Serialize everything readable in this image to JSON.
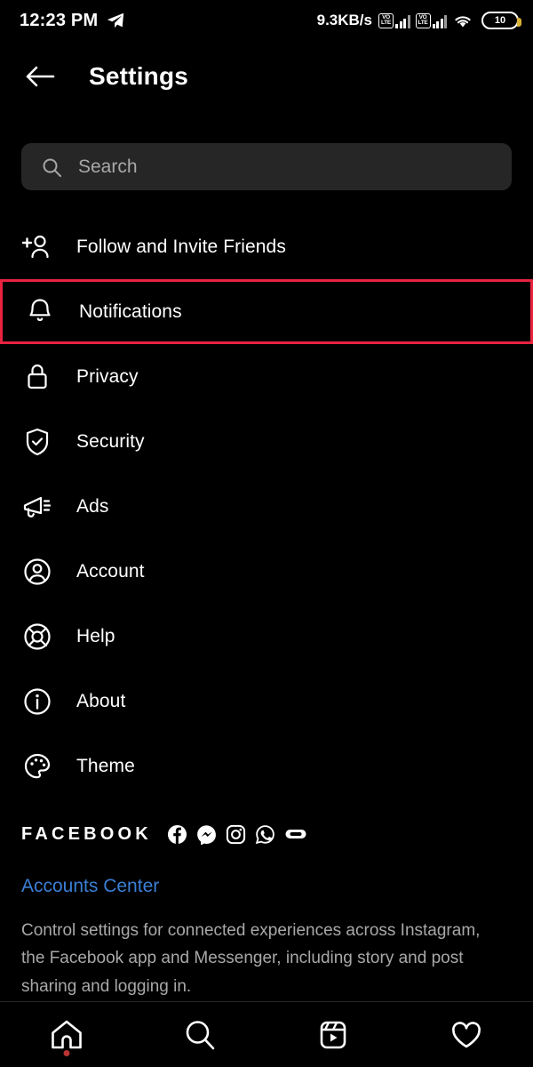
{
  "status_bar": {
    "time": "12:23 PM",
    "send_icon": "telegram-send-icon",
    "network_speed": "9.3KB/s",
    "volte_1": {
      "top": "VO",
      "bottom": "LTE"
    },
    "volte_2": {
      "top": "VO",
      "bottom": "LTE"
    },
    "wifi_icon": "wifi-icon",
    "battery_level": "10"
  },
  "header": {
    "back_icon": "back-arrow-icon",
    "title": "Settings"
  },
  "search": {
    "icon": "search-icon",
    "placeholder": "Search",
    "value": ""
  },
  "menu": {
    "items": [
      {
        "label": "Follow and Invite Friends",
        "icon": "person-add-icon",
        "highlighted": false
      },
      {
        "label": "Notifications",
        "icon": "bell-icon",
        "highlighted": true
      },
      {
        "label": "Privacy",
        "icon": "lock-icon",
        "highlighted": false
      },
      {
        "label": "Security",
        "icon": "shield-check-icon",
        "highlighted": false
      },
      {
        "label": "Ads",
        "icon": "megaphone-icon",
        "highlighted": false
      },
      {
        "label": "Account",
        "icon": "account-circle-icon",
        "highlighted": false
      },
      {
        "label": "Help",
        "icon": "lifebuoy-icon",
        "highlighted": false
      },
      {
        "label": "About",
        "icon": "info-circle-icon",
        "highlighted": false
      },
      {
        "label": "Theme",
        "icon": "palette-icon",
        "highlighted": false
      }
    ]
  },
  "facebook_section": {
    "brand_word": "FACEBOOK",
    "brand_icons": [
      "facebook-icon",
      "messenger-icon",
      "instagram-icon",
      "whatsapp-icon",
      "oculus-icon"
    ],
    "accounts_center_link": "Accounts Center",
    "description": "Control settings for connected experiences across Instagram, the Facebook app and Messenger, including story and post sharing and logging in."
  },
  "bottom_nav": {
    "items": [
      {
        "icon": "home-icon",
        "badge": true
      },
      {
        "icon": "search-icon",
        "badge": false
      },
      {
        "icon": "reels-icon",
        "badge": false
      },
      {
        "icon": "heart-icon",
        "badge": false
      }
    ]
  },
  "colors": {
    "background": "#000000",
    "highlight_red": "#e8233f",
    "link_blue": "#3a7fd5",
    "search_bg": "#262626",
    "muted_text": "#a8a8a8",
    "battery_tip": "#d9b23a"
  }
}
